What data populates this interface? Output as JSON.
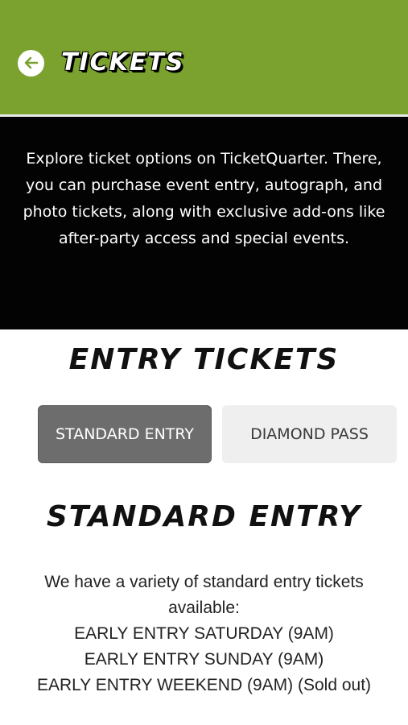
{
  "header": {
    "title": "TICKETS",
    "back_icon": "arrow-left-icon",
    "bg_color": "#7ba22f"
  },
  "intro": {
    "text": "Explore ticket options on TicketQuarter. There, you can purchase event entry, autograph, and photo tickets, along with exclusive add-ons like after-party access and special events."
  },
  "entry_tickets": {
    "title": "ENTRY TICKETS",
    "tabs": [
      {
        "label": "STANDARD ENTRY",
        "active": true
      },
      {
        "label": "DIAMOND PASS",
        "active": false
      }
    ]
  },
  "standard_entry": {
    "title": "STANDARD ENTRY",
    "description_lines": [
      "We have a variety of standard entry tickets",
      "available:",
      "EARLY ENTRY SATURDAY (9AM)",
      "EARLY ENTRY SUNDAY (9AM)",
      "EARLY ENTRY WEEKEND (9AM) (Sold out)"
    ]
  }
}
